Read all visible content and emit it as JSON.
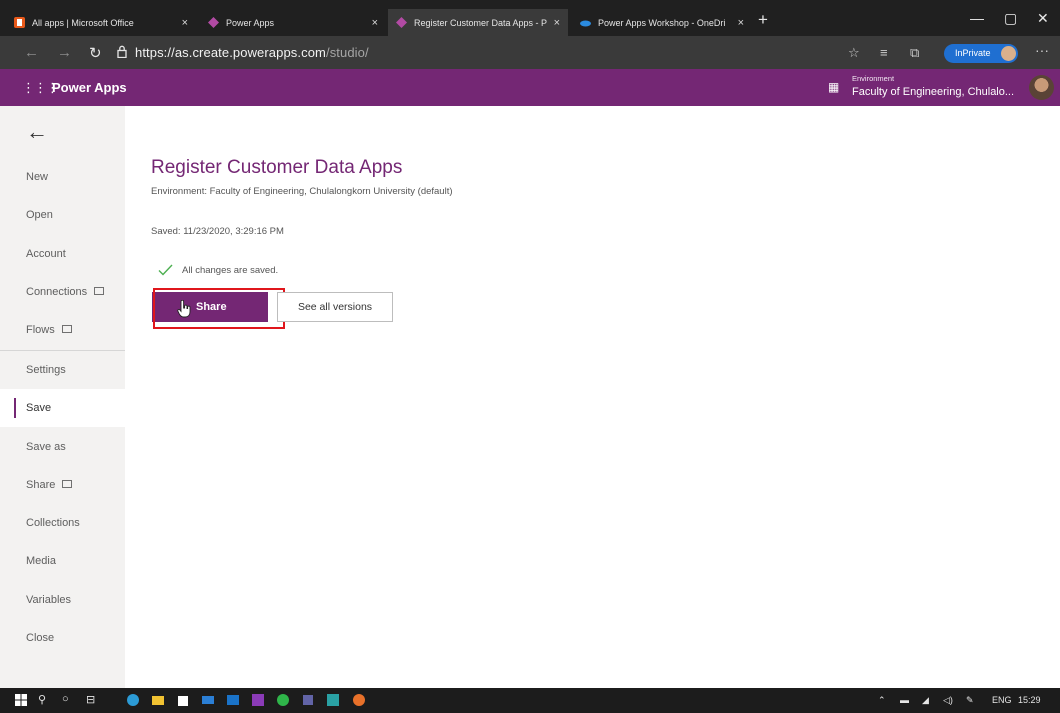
{
  "browser": {
    "tabs": [
      {
        "label": "All apps | Microsoft Office",
        "icon": "office-icon",
        "active": false
      },
      {
        "label": "Power Apps",
        "icon": "powerapps-icon",
        "active": false
      },
      {
        "label": "Register Customer Data Apps - P",
        "icon": "powerapps-icon",
        "active": true
      },
      {
        "label": "Power Apps Workshop - OneDri",
        "icon": "onedrive-icon",
        "active": false
      }
    ],
    "url_host": "https://as.create.powerapps.com",
    "url_path": "/studio/",
    "inprivate_label": "InPrivate"
  },
  "header": {
    "app_name": "Power Apps",
    "environment_label": "Environment",
    "environment_name": "Faculty of Engineering, Chulalo..."
  },
  "sidebar": {
    "back_label": "←",
    "items": [
      {
        "label": "New",
        "external": false,
        "selected": false
      },
      {
        "label": "Open",
        "external": false,
        "selected": false
      },
      {
        "label": "Account",
        "external": false,
        "selected": false
      },
      {
        "label": "Connections",
        "external": true,
        "selected": false
      },
      {
        "label": "Flows",
        "external": true,
        "selected": false
      },
      {
        "label": "Settings",
        "external": false,
        "selected": false
      },
      {
        "label": "Save",
        "external": false,
        "selected": true
      },
      {
        "label": "Save as",
        "external": false,
        "selected": false
      },
      {
        "label": "Share",
        "external": true,
        "selected": false
      },
      {
        "label": "Collections",
        "external": false,
        "selected": false
      },
      {
        "label": "Media",
        "external": false,
        "selected": false
      },
      {
        "label": "Variables",
        "external": false,
        "selected": false
      },
      {
        "label": "Close",
        "external": false,
        "selected": false
      }
    ]
  },
  "main": {
    "title": "Register Customer Data Apps",
    "environment_line": "Environment: Faculty of Engineering, Chulalongkorn University (default)",
    "saved_line": "Saved: 11/23/2020, 3:29:16 PM",
    "status_line": "All changes are saved.",
    "share_label": "Share",
    "versions_label": "See all versions"
  },
  "taskbar": {
    "language": "ENG",
    "time": "15:29"
  },
  "colors": {
    "brand": "#742774",
    "highlight": "#e0161c",
    "check": "#4caf50"
  }
}
